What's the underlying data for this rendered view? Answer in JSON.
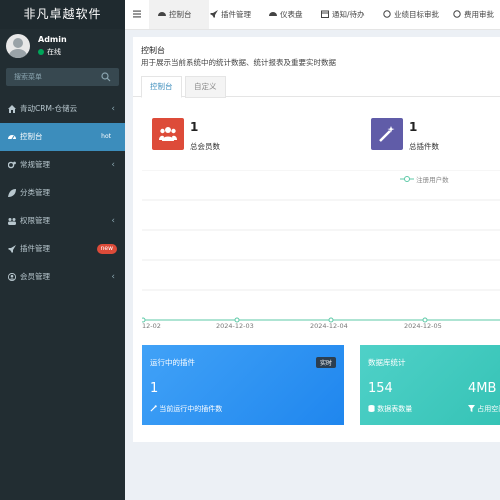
{
  "brand": "非凡卓越软件",
  "user": {
    "name": "Admin",
    "status": "在线"
  },
  "sidebar": {
    "search_placeholder": "搜索菜单",
    "items": [
      {
        "label": "青动CRM-仓储云",
        "icon": "home-icon",
        "chevron": true
      },
      {
        "label": "控制台",
        "icon": "dashboard-icon",
        "badge": "hot",
        "active": true
      },
      {
        "label": "常规管理",
        "icon": "cogs-icon",
        "chevron": true
      },
      {
        "label": "分类管理",
        "icon": "leaf-icon"
      },
      {
        "label": "权限管理",
        "icon": "group-icon",
        "chevron": true
      },
      {
        "label": "插件管理",
        "icon": "rocket-icon",
        "badge": "new"
      },
      {
        "label": "会员管理",
        "icon": "user-circle-icon",
        "chevron": true
      }
    ],
    "chevron_glyph": "‹"
  },
  "topnav": {
    "tabs": [
      {
        "label": "控制台",
        "icon": "dashboard-icon",
        "active": true
      },
      {
        "label": "插件管理",
        "icon": "rocket-icon"
      },
      {
        "label": "仪表盘",
        "icon": "dashboard-icon"
      },
      {
        "label": "通知/待办",
        "icon": "calendar-icon"
      },
      {
        "label": "业绩目标审批",
        "icon": "circle-icon"
      },
      {
        "label": "费用审批",
        "icon": "circle-icon"
      }
    ]
  },
  "panel": {
    "title": "控制台",
    "subtitle": "用于展示当前系统中的统计数据、统计报表及重要实时数据",
    "subtabs": [
      "控制台",
      "自定义"
    ]
  },
  "stats": [
    {
      "value": "1",
      "label": "总会员数",
      "color": "#dd4b39",
      "icon": "users-icon"
    },
    {
      "value": "1",
      "label": "总插件数",
      "color": "#605ca8",
      "icon": "magic-icon"
    }
  ],
  "chart_data": {
    "type": "line",
    "series": [
      {
        "name": "注册用户数",
        "values": [
          0,
          0,
          0,
          0
        ]
      }
    ],
    "categories": [
      "2024-12-02",
      "2024-12-03",
      "2024-12-04",
      "2024-12-05"
    ],
    "x_tick_labels": [
      "12-02",
      "2024-12-03",
      "2024-12-04",
      "2024-12-05"
    ],
    "legend": "top-right",
    "grid": true,
    "color": "#5cc9a7"
  },
  "cards": {
    "plugins": {
      "title": "运行中的插件",
      "badge": "实时",
      "value": "1",
      "sub": "当前运行中的插件数"
    },
    "db": {
      "title": "数据库统计",
      "value1": "154",
      "value2": "4MB",
      "sub1": "数据表数量",
      "sub2": "占用空间"
    }
  }
}
